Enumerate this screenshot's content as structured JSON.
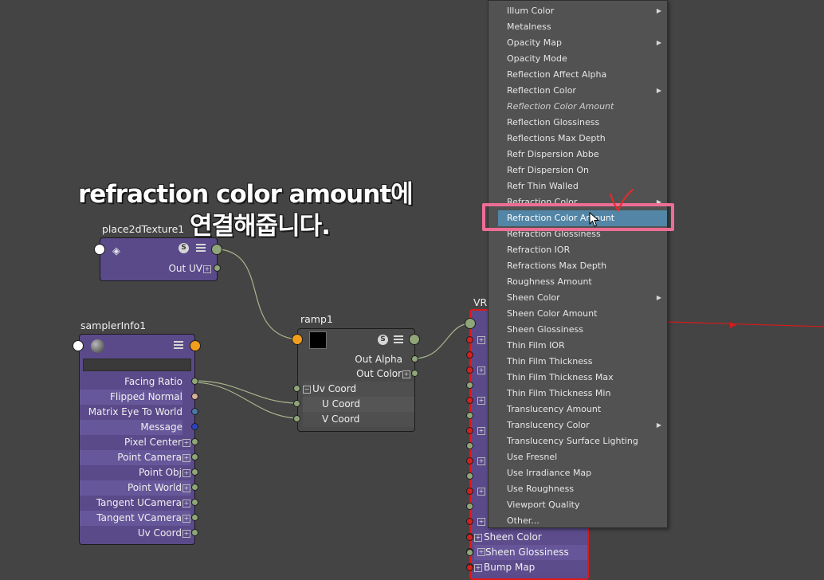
{
  "annotation": {
    "line1": "refraction color amount에",
    "line2": "연결해줍니다."
  },
  "nodes": {
    "place2d": {
      "title": "place2dTexture1",
      "attrs": [
        {
          "label": "Out UV",
          "expandable": true
        }
      ]
    },
    "sampler": {
      "title": "samplerInfo1",
      "attrs": [
        {
          "label": "Facing Ratio",
          "expandable": false
        },
        {
          "label": "Flipped Normal",
          "expandable": false
        },
        {
          "label": "Matrix Eye To World",
          "expandable": false
        },
        {
          "label": "Message",
          "expandable": false
        },
        {
          "label": "Pixel Center",
          "expandable": true
        },
        {
          "label": "Point Camera",
          "expandable": true
        },
        {
          "label": "Point Obj",
          "expandable": true
        },
        {
          "label": "Point World",
          "expandable": true
        },
        {
          "label": "Tangent UCamera",
          "expandable": true
        },
        {
          "label": "Tangent VCamera",
          "expandable": true
        },
        {
          "label": "Uv Coord",
          "expandable": true
        }
      ]
    },
    "ramp": {
      "title": "ramp1",
      "outputs": [
        {
          "label": "Out Alpha",
          "expandable": false
        },
        {
          "label": "Out Color",
          "expandable": true
        }
      ],
      "inputs": [
        {
          "label": "Uv Coord",
          "expandable": true
        },
        {
          "label": "U Coord"
        },
        {
          "label": "V Coord"
        }
      ]
    },
    "vray": {
      "title": "VR",
      "attrs": [
        "Sheen Color",
        "Sheen Glossiness",
        "Bump Map"
      ]
    }
  },
  "context_menu": {
    "items": [
      {
        "label": "Illum Color",
        "submenu": true
      },
      {
        "label": "Metalness"
      },
      {
        "label": "Opacity Map",
        "submenu": true
      },
      {
        "label": "Opacity Mode"
      },
      {
        "label": "Reflection Affect Alpha"
      },
      {
        "label": "Reflection Color",
        "submenu": true
      },
      {
        "label": "Reflection Color Amount",
        "italic": true
      },
      {
        "label": "Reflection Glossiness"
      },
      {
        "label": "Reflections Max Depth"
      },
      {
        "label": "Refr Dispersion Abbe"
      },
      {
        "label": "Refr Dispersion On"
      },
      {
        "label": "Refr Thin Walled"
      },
      {
        "label": "Refraction Color",
        "submenu": true
      },
      {
        "label": "Refraction Color Amount",
        "highlight": true
      },
      {
        "label": "Refraction Glossiness"
      },
      {
        "label": "Refraction IOR"
      },
      {
        "label": "Refractions Max Depth"
      },
      {
        "label": "Roughness Amount"
      },
      {
        "label": "Sheen Color",
        "submenu": true
      },
      {
        "label": "Sheen Color Amount"
      },
      {
        "label": "Sheen Glossiness"
      },
      {
        "label": "Thin Film IOR"
      },
      {
        "label": "Thin Film Thickness"
      },
      {
        "label": "Thin Film Thickness Max"
      },
      {
        "label": "Thin Film Thickness Min"
      },
      {
        "label": "Translucency Amount"
      },
      {
        "label": "Translucency Color",
        "submenu": true
      },
      {
        "label": "Translucency Surface Lighting"
      },
      {
        "label": "Use Fresnel"
      },
      {
        "label": "Use Irradiance Map"
      },
      {
        "label": "Use Roughness"
      },
      {
        "label": "Viewport Quality"
      },
      {
        "label": "Other..."
      }
    ]
  },
  "colors": {
    "canvas": "#444444",
    "node_purple": "#5a4a8a",
    "highlight_box": "#ee6d95",
    "menu_highlight": "#5285a6",
    "selected_node_border": "#e01818"
  },
  "icons": {
    "solo": "s-badge-icon",
    "attribute_list": "attribute-list-icon",
    "submenu": "submenu-arrow-icon"
  }
}
